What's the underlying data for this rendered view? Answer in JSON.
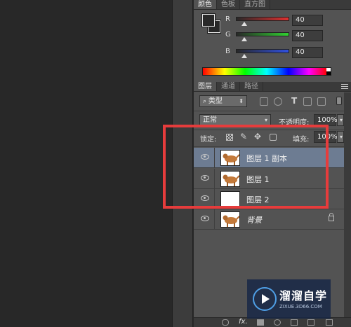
{
  "color_panel": {
    "tabs": [
      {
        "label": "颜色"
      },
      {
        "label": "色板"
      },
      {
        "label": "直方图"
      }
    ],
    "channels": [
      {
        "label": "R",
        "value": "40",
        "gradient_color": "#e03030"
      },
      {
        "label": "G",
        "value": "40",
        "gradient_color": "#30d030"
      },
      {
        "label": "B",
        "value": "40",
        "gradient_color": "#3050e0"
      }
    ],
    "foreground_color": "#282828"
  },
  "layers_panel": {
    "tabs": [
      {
        "label": "图层"
      },
      {
        "label": "通道"
      },
      {
        "label": "路径"
      }
    ],
    "filter": {
      "label": "类型"
    },
    "blend_mode": "正常",
    "opacity": {
      "label": "不透明度:",
      "value": "100%"
    },
    "lock_label": "锁定:",
    "fill": {
      "label": "填充:",
      "value": "100%"
    },
    "layers": [
      {
        "name": "图层 1 副本",
        "thumbnail": "dog-image",
        "selected": true
      },
      {
        "name": "图层 1",
        "thumbnail": "dog-image",
        "selected": false
      },
      {
        "name": "图层 2",
        "thumbnail": "white",
        "selected": false
      },
      {
        "name": "背景",
        "thumbnail": "dog-image",
        "locked": true,
        "selected": false
      }
    ],
    "footer_fx_label": "fx."
  },
  "watermark": {
    "title": "溜溜自学",
    "url": "ZIXUE.3D66.COM"
  },
  "colors": {
    "highlight": "#e63c3c",
    "selected_row": "#6d7c92"
  }
}
